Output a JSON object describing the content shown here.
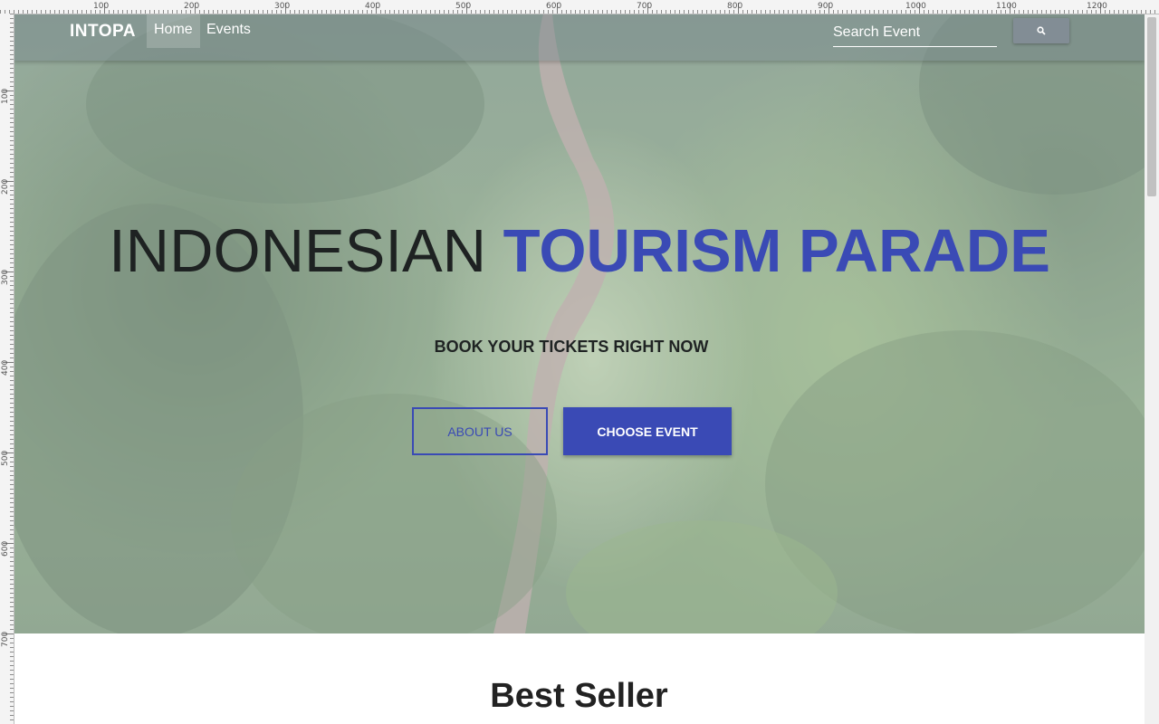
{
  "navbar": {
    "brand": "INTOPA",
    "links": [
      "Home",
      "Events"
    ],
    "search_placeholder": "Search Event",
    "search_icon": "search-icon"
  },
  "hero": {
    "title_light": "INDONESIAN ",
    "title_strong": "TOURISM PARADE",
    "subtitle": "BOOK YOUR TICKETS RIGHT NOW",
    "about_label": "ABOUT US",
    "choose_label": "CHOOSE EVENT",
    "accent_color": "#3a4ab5"
  },
  "sections": {
    "best_seller_title": "Best Seller"
  },
  "ruler": {
    "top": [
      "100",
      "200",
      "300",
      "400",
      "500",
      "600",
      "700",
      "800",
      "900",
      "1000",
      "1100",
      "1200"
    ],
    "left": [
      "100",
      "200",
      "300",
      "400",
      "500",
      "600",
      "700"
    ]
  }
}
